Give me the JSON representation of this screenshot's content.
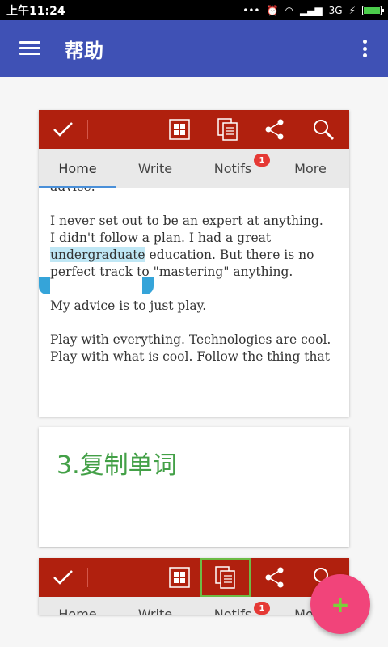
{
  "status_bar": {
    "time": "上午11:24",
    "network": "3G"
  },
  "app_bar": {
    "title": "帮助",
    "menu_icon": "menu-icon",
    "more_icon": "more-vert-icon"
  },
  "card1": {
    "tabs": [
      {
        "label": "Home"
      },
      {
        "label": "Write"
      },
      {
        "label": "Notifs",
        "badge": "1"
      },
      {
        "label": "More"
      }
    ],
    "document": {
      "line0": "advice.",
      "p1_before": "I never set out to be an expert at anything.  I didn't follow a plan.  I had a great ",
      "p1_selected": "undergraduate",
      "p1_after": " education.  But there is no perfect track to \"mastering\" anything.",
      "p2": "My advice is to just play.",
      "p3": "Play with everything.   Technologies are cool. Play with what is cool.   Follow the thing that"
    }
  },
  "card2": {
    "step_title": "3.复制单词"
  },
  "card3": {
    "tabs": [
      {
        "label": "Home"
      },
      {
        "label": "Write"
      },
      {
        "label": "Notifs",
        "badge": "1"
      },
      {
        "label": "More"
      }
    ]
  },
  "fab": {
    "label": "+"
  },
  "colors": {
    "app_bar": "#3f51b5",
    "toolbar": "#b0200e",
    "step_title": "#43a047",
    "fab": "#f1447a"
  }
}
